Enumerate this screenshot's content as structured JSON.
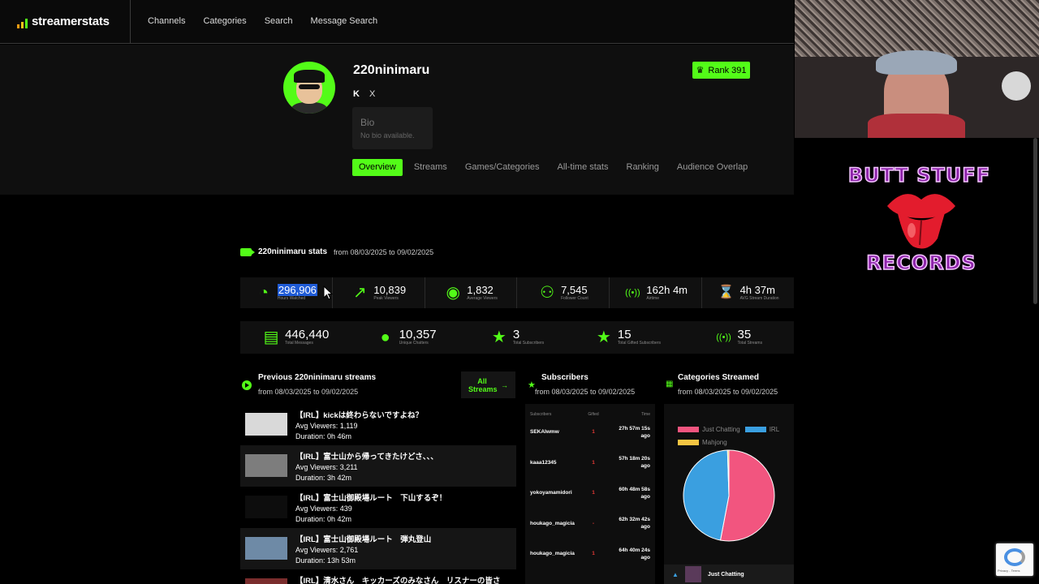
{
  "nav": {
    "brand": "streamerstats",
    "links": [
      "Channels",
      "Categories",
      "Search",
      "Message Search"
    ]
  },
  "profile": {
    "name": "220ninimaru",
    "social": [
      "K",
      "X"
    ],
    "bio_title": "Bio",
    "bio_text": "No bio available.",
    "rank": "Rank 391",
    "tabs": [
      "Overview",
      "Streams",
      "Games/Categories",
      "All-time stats",
      "Ranking",
      "Audience Overlap"
    ],
    "active_tab": "Overview"
  },
  "stats": {
    "title": "220ninimaru stats",
    "range": "from 08/03/2025 to 09/02/2025",
    "row1": [
      {
        "value": "296,906",
        "label": "Hours Watched",
        "icon": "clock-icon",
        "glyph": "◔"
      },
      {
        "value": "10,839",
        "label": "Peak Viewers",
        "icon": "trend-up-icon",
        "glyph": "↗"
      },
      {
        "value": "1,832",
        "label": "Average Viewers",
        "icon": "eye-icon",
        "glyph": "◉"
      },
      {
        "value": "7,545",
        "label": "Follower Count",
        "icon": "user-add-icon",
        "glyph": "⚇"
      },
      {
        "value": "162h 4m",
        "label": "Airtime",
        "icon": "broadcast-icon",
        "glyph": "((•))"
      },
      {
        "value": "4h 37m",
        "label": "AVG Stream Duration",
        "icon": "hourglass-icon",
        "glyph": "⌛"
      }
    ],
    "row2": [
      {
        "value": "446,440",
        "label": "Total Messages",
        "icon": "message-icon",
        "glyph": "▤"
      },
      {
        "value": "10,357",
        "label": "Unique Chatters",
        "icon": "user-icon",
        "glyph": "●"
      },
      {
        "value": "3",
        "label": "Total Subscribers",
        "icon": "star-icon",
        "glyph": "★"
      },
      {
        "value": "15",
        "label": "Total Gifted Subscribers",
        "icon": "star-icon",
        "glyph": "★"
      },
      {
        "value": "35",
        "label": "Total Streams",
        "icon": "broadcast-icon",
        "glyph": "((•))"
      }
    ]
  },
  "streams": {
    "title": "Previous 220ninimaru streams",
    "range": "from 08/03/2025 to 09/02/2025",
    "all_label": "All Streams",
    "items": [
      {
        "title": "【IRL】kickは終わらないですよね？",
        "avg": "Avg Viewers: 1,119",
        "duration": "Duration: 0h 46m",
        "thumb": "#d9d9d9"
      },
      {
        "title": "【IRL】富士山から帰ってきたけどさ、、、",
        "avg": "Avg Viewers: 3,211",
        "duration": "Duration: 3h 42m",
        "thumb": "#7d7d7d"
      },
      {
        "title": "【IRL】富士山御殿場ルート　下山するぞ！",
        "avg": "Avg Viewers: 439",
        "duration": "Duration: 0h 42m",
        "thumb": "#0d0d0d"
      },
      {
        "title": "【IRL】富士山御殿場ルート　弾丸登山",
        "avg": "Avg Viewers: 2,761",
        "duration": "Duration: 13h 53m",
        "thumb": "#6e8aa6"
      },
      {
        "title": "【IRL】清水さん　キッカーズのみなさん　リスナーの皆さん...",
        "avg": "",
        "duration": "",
        "thumb": "#7a2d2d"
      }
    ]
  },
  "subscribers": {
    "title": "Subscribers",
    "range": "from 08/03/2025 to 09/02/2025",
    "headers": [
      "Subscribers",
      "Gifted",
      "Time"
    ],
    "rows": [
      {
        "name": "SEKAIwmw",
        "gifted": "1",
        "time": "27h 57m 15s ago"
      },
      {
        "name": "kaaa12345",
        "gifted": "1",
        "time": "57h 18m 20s ago"
      },
      {
        "name": "yokoyamamidori",
        "gifted": "1",
        "time": "60h 48m 58s ago"
      },
      {
        "name": "houkago_magicia",
        "gifted": "-",
        "time": "62h 32m 42s ago"
      },
      {
        "name": "houkago_magicia",
        "gifted": "1",
        "time": "64h 40m 24s ago"
      }
    ]
  },
  "categories": {
    "title": "Categories Streamed",
    "range": "from 08/03/2025 to 09/02/2025",
    "footer_item": "Just Chatting"
  },
  "chart_data": {
    "type": "pie",
    "categories": [
      "Just Chatting",
      "IRL",
      "Mahjong"
    ],
    "values": [
      53,
      46.5,
      0.5
    ],
    "colors": [
      "#f2557f",
      "#3a9fe0",
      "#f5c542"
    ],
    "legend": "top"
  },
  "overlay": {
    "line1": "BUTT STUFF",
    "line2": "RECORDS"
  },
  "recaptcha": {
    "text": "Privacy - Terms"
  },
  "colors": {
    "accent": "#53fc18",
    "background": "#000000",
    "panel": "#101010"
  }
}
